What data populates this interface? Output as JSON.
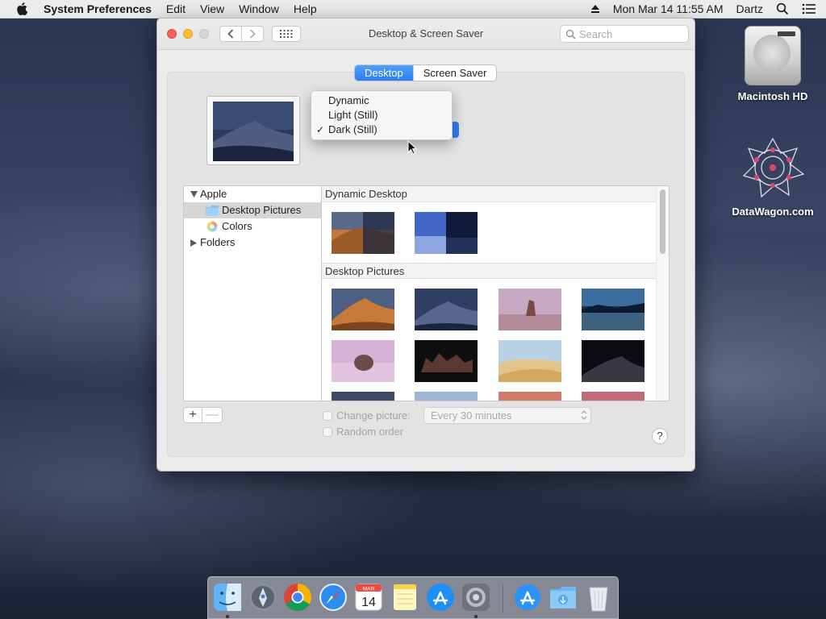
{
  "menubar": {
    "app_name": "System Preferences",
    "menus": [
      "Edit",
      "View",
      "Window",
      "Help"
    ],
    "clock": "Mon Mar 14  11:55 AM",
    "user": "Dartz"
  },
  "desktop": {
    "icons": [
      {
        "label": "Macintosh HD"
      },
      {
        "label": "DataWagon.com"
      }
    ]
  },
  "window": {
    "title": "Desktop & Screen Saver",
    "search_placeholder": "Search",
    "tabs": [
      {
        "label": "Desktop",
        "active": true
      },
      {
        "label": "Screen Saver",
        "active": false
      }
    ],
    "appearance_menu": {
      "options": [
        "Dynamic",
        "Light (Still)",
        "Dark (Still)"
      ],
      "selected": "Dark (Still)"
    },
    "sidebar": {
      "items": [
        "Apple",
        "Desktop Pictures",
        "Colors",
        "Folders"
      ],
      "selected": "Desktop Pictures"
    },
    "sections": [
      "Dynamic Desktop",
      "Desktop Pictures"
    ],
    "change_picture_label": "Change picture:",
    "interval_value": "Every 30 minutes",
    "random_order_label": "Random order",
    "plus_label": "+",
    "minus_label": "—",
    "help_label": "?"
  },
  "dock": {
    "apps": [
      "Finder",
      "Launchpad",
      "Chrome",
      "Safari",
      "Calendar",
      "Notes",
      "App Store",
      "System Preferences",
      "App Store Downloads",
      "Downloads",
      "Trash"
    ],
    "calendar_month": "MAR",
    "calendar_day": "14"
  },
  "colors": {
    "accent": "#2b7cf0",
    "close": "#fe5f57",
    "minimize": "#febc2e"
  }
}
